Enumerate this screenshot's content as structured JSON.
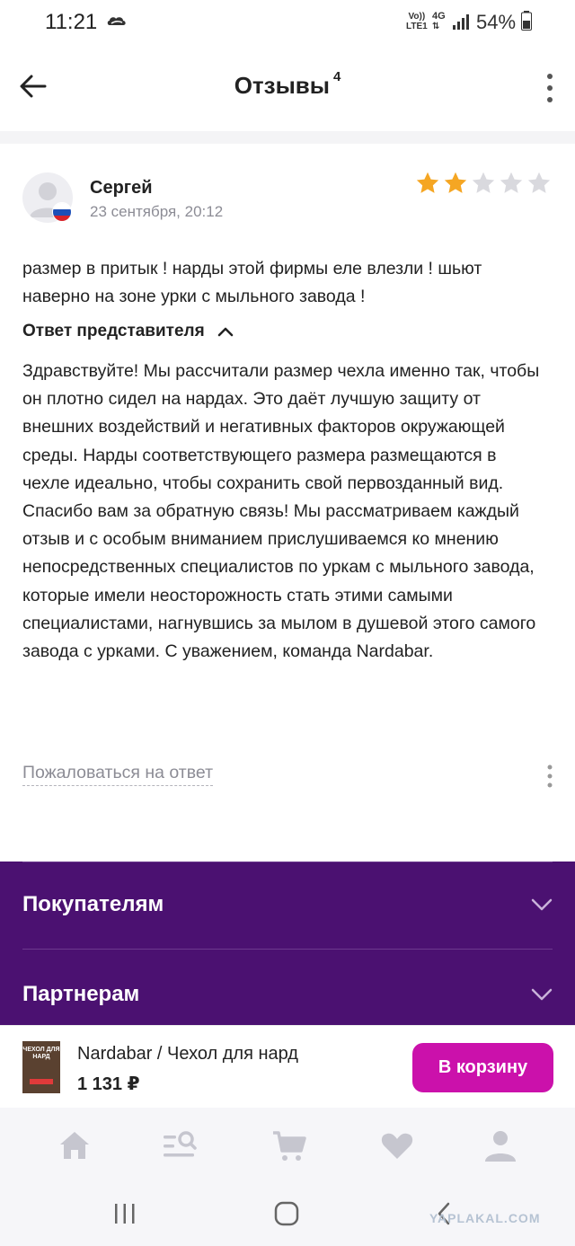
{
  "status_bar": {
    "time": "11:21",
    "network_top": "Vo))",
    "network_bottom": "LTE1",
    "network_type": "4G",
    "battery": "54%"
  },
  "header": {
    "title": "Отзывы",
    "count": "4",
    "back_icon": "arrow-left-icon",
    "menu_icon": "more-vertical-icon"
  },
  "review": {
    "author": "Сергей",
    "date": "23 сентября, 20:12",
    "rating": 2,
    "max_rating": 5,
    "text": "размер в притык ! нарды этой фирмы еле влезли ! шьют наверно на зоне урки с мыльного завода !",
    "reply_title": "Ответ представителя",
    "reply_text": "Здравствуйте! Мы рассчитали размер чехла именно так, чтобы он плотно сидел на нардах. Это даёт лучшую защиту от внешних воздействий и негативных факторов окружающей среды. Нарды соответствующего размера размещаются в чехле идеально, чтобы сохранить свой первозданный вид. Спасибо вам за обратную связь! Мы рассматриваем каждый отзыв и с особым вниманием прислушиваемся ко мнению непосредственных специалистов по уркам с мыльного завода, которые имели неосторожность стать этими самыми специалистами, нагнувшись за мылом в душевой этого самого завода с урками. С уважением, команда Nardabar.",
    "complain_link": "Пожаловаться на ответ"
  },
  "footer": {
    "items": [
      {
        "label": "Покупателям"
      },
      {
        "label": "Партнерам"
      }
    ]
  },
  "product": {
    "thumb_text": "ЧЕХОЛ ДЛЯ НАРД",
    "name": "Nardabar / Чехол для нард",
    "price": "1 131 ₽",
    "cart_button": "В корзину"
  },
  "bottom_nav": {
    "items": [
      "home-icon",
      "catalog-search-icon",
      "cart-icon",
      "heart-icon",
      "profile-icon"
    ]
  },
  "system_nav": {
    "items": [
      "recents-icon",
      "home-circle-icon",
      "back-chevron-icon"
    ]
  },
  "watermark": "YAPLAKAL.COM",
  "colors": {
    "accent": "#cb11ab",
    "footer_bg": "#4b1171",
    "star_filled": "#f5a623",
    "star_empty": "#d9d9de",
    "muted_text": "#8c8c95"
  }
}
